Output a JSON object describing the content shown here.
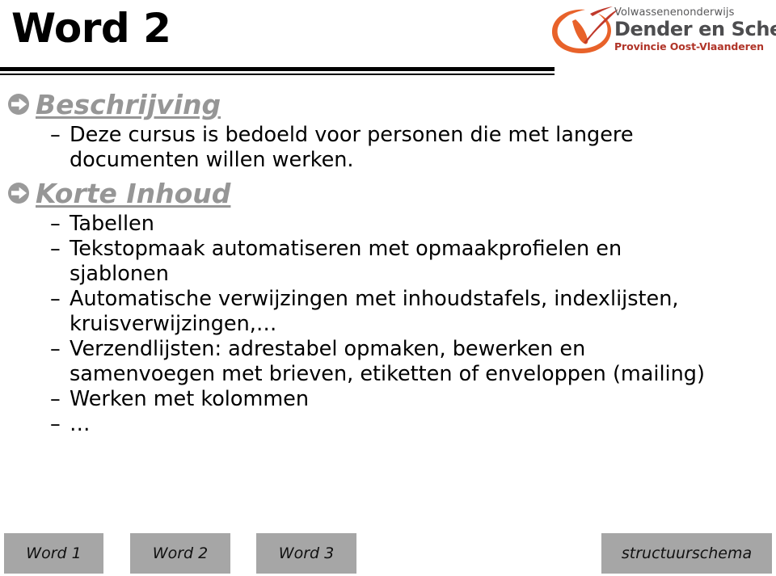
{
  "slide": {
    "title": "Word 2",
    "divider": {
      "style": "double-rule",
      "color": "#000000"
    }
  },
  "logo": {
    "mark_name": "vdos-swoosh-logo",
    "line1": "Volwassenenonderwijs",
    "line2": "Dender en Schelde",
    "line3": "Provincie Oost-Vlaanderen",
    "colors": {
      "swoosh_orange": "#e8622a",
      "swoosh_red": "#c0392b",
      "line1_gray": "#58585a",
      "line2_gray": "#4d4d4f",
      "line3_red": "#b03428"
    }
  },
  "content": {
    "heading_color": "#969696",
    "bullet_icon": "circle-arrow-right-icon",
    "dash_marker": "–",
    "sections": [
      {
        "id": "beschrijving",
        "heading": "Beschrijving",
        "items": [
          "Deze cursus is bedoeld voor personen die met langere documenten willen werken."
        ]
      },
      {
        "id": "korte-inhoud",
        "heading": "Korte Inhoud",
        "items": [
          "Tabellen",
          "Tekstopmaak automatiseren met opmaakprofielen en sjablonen",
          "Automatische verwijzingen met inhoudstafels, indexlijsten, kruisverwijzingen,…",
          "Verzendlijsten: adrestabel opmaken, bewerken en samenvoegen met brieven, etiketten of enveloppen (mailing)",
          "Werken met kolommen",
          "…"
        ]
      }
    ]
  },
  "footer": {
    "background": "#a6a6a6",
    "buttons": [
      {
        "label": "Word 1",
        "name": "nav-word-1"
      },
      {
        "label": "Word 2",
        "name": "nav-word-2"
      },
      {
        "label": "Word 3",
        "name": "nav-word-3"
      },
      {
        "label": "structuurschema",
        "name": "nav-structuurschema"
      }
    ]
  }
}
